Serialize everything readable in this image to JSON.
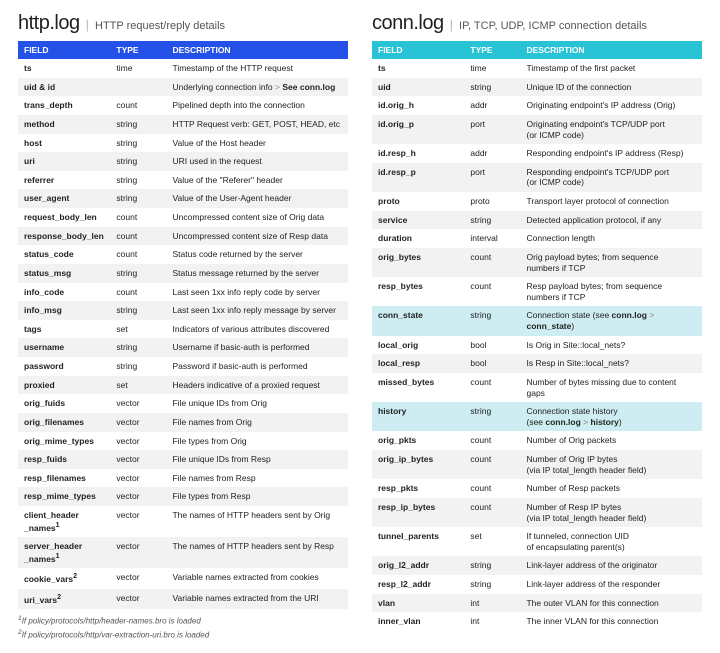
{
  "left": {
    "title": "http.log",
    "subtitle": "HTTP request/reply details",
    "headers": [
      "FIELD",
      "TYPE",
      "DESCRIPTION"
    ],
    "rows": [
      {
        "f": "ts",
        "t": "time",
        "d": "Timestamp of the HTTP request"
      },
      {
        "f": "uid & id",
        "t": "",
        "d": "Underlying connection info <span class='gt'>&gt;</span> <b class='inline'>See conn.log</b>"
      },
      {
        "f": "trans_depth",
        "t": "count",
        "d": "Pipelined depth into the connection"
      },
      {
        "f": "method",
        "t": "string",
        "d": "HTTP Request verb: GET, POST, HEAD, etc"
      },
      {
        "f": "host",
        "t": "string",
        "d": "Value of the Host header"
      },
      {
        "f": "uri",
        "t": "string",
        "d": "URI used in the request"
      },
      {
        "f": "referrer",
        "t": "string",
        "d": "Value of the \"Referer\" header"
      },
      {
        "f": "user_agent",
        "t": "string",
        "d": "Value of the User-Agent header"
      },
      {
        "f": "request_body_len",
        "t": "count",
        "d": "Uncompressed content size of Orig data"
      },
      {
        "f": "response_body_len",
        "t": "count",
        "d": "Uncompressed content size of Resp data"
      },
      {
        "f": "status_code",
        "t": "count",
        "d": "Status code returned by the server"
      },
      {
        "f": "status_msg",
        "t": "string",
        "d": "Status message returned by the server"
      },
      {
        "f": "info_code",
        "t": "count",
        "d": "Last seen 1xx info reply code by server"
      },
      {
        "f": "info_msg",
        "t": "string",
        "d": "Last seen 1xx info reply message by server"
      },
      {
        "f": "tags",
        "t": "set",
        "d": "Indicators of various attributes discovered"
      },
      {
        "f": "username",
        "t": "string",
        "d": "Username if basic-auth is performed"
      },
      {
        "f": "password",
        "t": "string",
        "d": "Password if basic-auth is performed"
      },
      {
        "f": "proxied",
        "t": "set",
        "d": "Headers indicative of a proxied request"
      },
      {
        "f": "orig_fuids",
        "t": "vector",
        "d": "File unique IDs from Orig"
      },
      {
        "f": "orig_filenames",
        "t": "vector",
        "d": "File names from Orig"
      },
      {
        "f": "orig_mime_types",
        "t": "vector",
        "d": "File types from Orig"
      },
      {
        "f": "resp_fuids",
        "t": "vector",
        "d": "File unique IDs from Resp"
      },
      {
        "f": "resp_filenames",
        "t": "vector",
        "d": "File names from Resp"
      },
      {
        "f": "resp_mime_types",
        "t": "vector",
        "d": "File types from Resp"
      },
      {
        "f": "client_header<br>_names<sup>1</sup>",
        "t": "vector",
        "d": "The names of HTTP headers sent by Orig"
      },
      {
        "f": "server_header<br>_names<sup>1</sup>",
        "t": "vector",
        "d": "The names of HTTP headers sent by Resp"
      },
      {
        "f": "cookie_vars<sup>2</sup>",
        "t": "vector",
        "d": "Variable names extracted from cookies"
      },
      {
        "f": "uri_vars<sup>2</sup>",
        "t": "vector",
        "d": "Variable names extracted from the URI"
      }
    ],
    "footnotes": [
      "<sup>1</sup>If policy/protocols/http/header-names.bro is loaded",
      "<sup>2</sup>If policy/protocols/http/var-extraction-uri.bro is loaded"
    ]
  },
  "right": {
    "title": "conn.log",
    "subtitle": "IP, TCP, UDP, ICMP connection details",
    "headers": [
      "FIELD",
      "TYPE",
      "DESCRIPTION"
    ],
    "rows": [
      {
        "f": "ts",
        "t": "time",
        "d": "Timestamp of the first packet"
      },
      {
        "f": "uid",
        "t": "string",
        "d": "Unique ID of the connection"
      },
      {
        "f": "id.orig_h",
        "t": "addr",
        "d": "Originating endpoint's IP address (Orig)"
      },
      {
        "f": "id.orig_p",
        "t": "port",
        "d": "Originating endpoint's TCP/UDP port<br>(or ICMP code)"
      },
      {
        "f": "id.resp_h",
        "t": "addr",
        "d": "Responding endpoint's IP address (Resp)"
      },
      {
        "f": "id.resp_p",
        "t": "port",
        "d": "Responding endpoint's TCP/UDP port<br>(or ICMP code)"
      },
      {
        "f": "proto",
        "t": "proto",
        "d": "Transport layer protocol of connection"
      },
      {
        "f": "service",
        "t": "string",
        "d": "Detected application protocol, if any"
      },
      {
        "f": "duration",
        "t": "interval",
        "d": "Connection length"
      },
      {
        "f": "orig_bytes",
        "t": "count",
        "d": "Orig payload bytes; from sequence<br>numbers if TCP"
      },
      {
        "f": "resp_bytes",
        "t": "count",
        "d": "Resp payload bytes; from sequence<br>numbers if TCP"
      },
      {
        "f": "conn_state",
        "t": "string",
        "d": "Connection state (see <b class='inline'>conn.log</b> <span class='gt'>&gt;</span> <b class='inline'>conn_state</b>)",
        "hl": true
      },
      {
        "f": "local_orig",
        "t": "bool",
        "d": "Is Orig in Site::local_nets?"
      },
      {
        "f": "local_resp",
        "t": "bool",
        "d": "Is Resp in Site::local_nets?"
      },
      {
        "f": "missed_bytes",
        "t": "count",
        "d": "Number of bytes missing due to content gaps"
      },
      {
        "f": "history",
        "t": "string",
        "d": "Connection state history<br>(see <b class='inline'>conn.log</b> <span class='gt'>&gt;</span> <b class='inline'>history</b>)",
        "hl": true
      },
      {
        "f": "orig_pkts",
        "t": "count",
        "d": "Number of Orig packets"
      },
      {
        "f": "orig_ip_bytes",
        "t": "count",
        "d": "Number of Orig IP bytes<br>(via IP total_length header field)"
      },
      {
        "f": "resp_pkts",
        "t": "count",
        "d": "Number of Resp packets"
      },
      {
        "f": "resp_ip_bytes",
        "t": "count",
        "d": "Number of Resp IP bytes<br>(via IP total_length header field)"
      },
      {
        "f": "tunnel_parents",
        "t": "set",
        "d": "If tunneled, connection UID<br>of encapsulating parent(s)"
      },
      {
        "f": "orig_l2_addr",
        "t": "string",
        "d": "Link-layer address of the originator"
      },
      {
        "f": "resp_l2_addr",
        "t": "string",
        "d": "Link-layer address of the responder"
      },
      {
        "f": "vlan",
        "t": "int",
        "d": "The outer VLAN for this connection"
      },
      {
        "f": "inner_vlan",
        "t": "int",
        "d": "The inner VLAN for this connection"
      }
    ]
  }
}
